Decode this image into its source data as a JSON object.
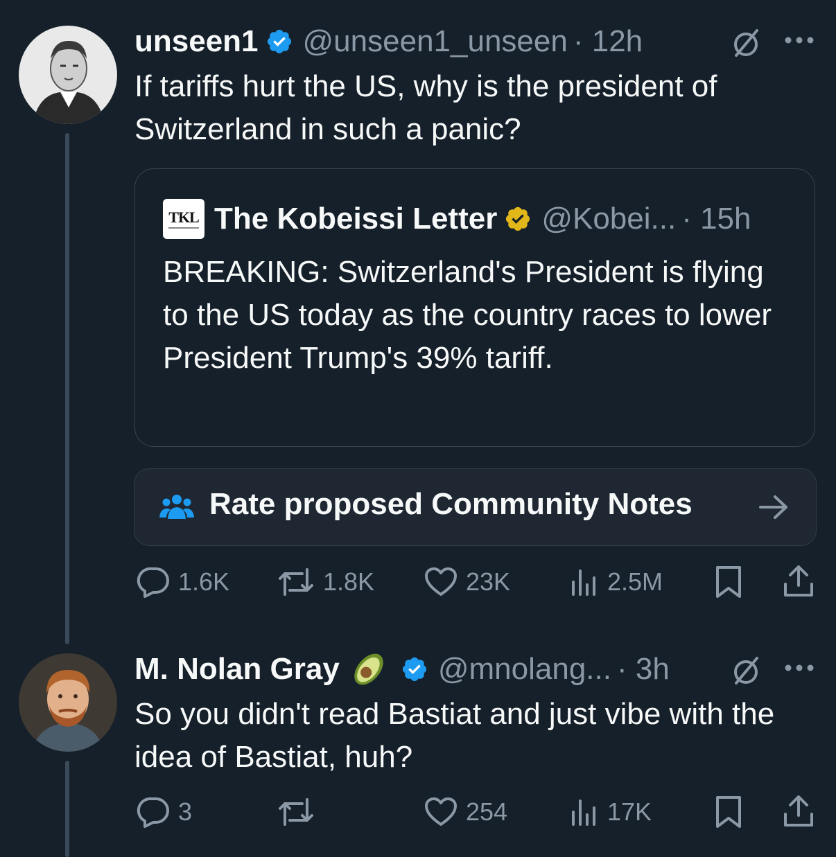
{
  "tweet1": {
    "name": "unseen1",
    "handle": "@unseen1_unseen",
    "time": "· 12h",
    "text": "If tariffs hurt the US, why is the president of Switzerland in such a panic?",
    "quote": {
      "logo_text": "TKL",
      "name": "The Kobeissi Letter",
      "handle": "@Kobei...",
      "time": "· 15h",
      "text": "BREAKING: Switzerland's President is flying to the US today as the country races to lower President Trump's 39% tariff."
    },
    "community_notes_label": "Rate proposed Community Notes",
    "stats": {
      "replies": "1.6K",
      "reposts": "1.8K",
      "likes": "23K",
      "views": "2.5M"
    }
  },
  "tweet2": {
    "name": "M. Nolan Gray",
    "emoji": "avocado",
    "handle": "@mnolang...",
    "time": "· 3h",
    "text": "So you didn't read Bastiat and just vibe with the idea of Bastiat, huh?",
    "stats": {
      "replies": "3",
      "reposts": "",
      "likes": "254",
      "views": "17K"
    }
  },
  "colors": {
    "background": "#16202a",
    "text": "#f7f9f9",
    "muted": "#8b98a5",
    "verified_blue": "#1d9bf0",
    "verified_gold": "#e2b719",
    "border": "#38444d"
  },
  "icons": [
    "verified-badge-icon",
    "grok-icon",
    "more-icon",
    "people-icon",
    "arrow-right-icon",
    "reply-icon",
    "repost-icon",
    "like-icon",
    "views-icon",
    "bookmark-icon",
    "share-icon"
  ]
}
